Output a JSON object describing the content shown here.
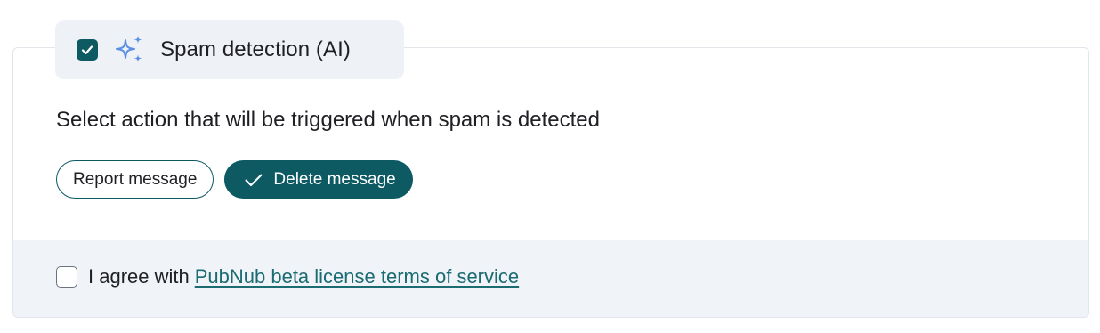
{
  "colors": {
    "accent": "#0d5a63",
    "link": "#1a6b72",
    "sparkle": "#5b8fe6",
    "footer_bg": "#f0f3f7",
    "legend_bg": "#eef2f6"
  },
  "section": {
    "enabled": true,
    "icon": "sparkle-icon",
    "title": "Spam detection (AI)"
  },
  "prompt": "Select action that will be triggered when spam is detected",
  "actions": [
    {
      "label": "Report message",
      "selected": false
    },
    {
      "label": "Delete message",
      "selected": true,
      "icon": "checkmark-icon"
    }
  ],
  "agreement": {
    "checked": false,
    "text": "I agree with",
    "link_text": "PubNub beta license terms of service"
  }
}
